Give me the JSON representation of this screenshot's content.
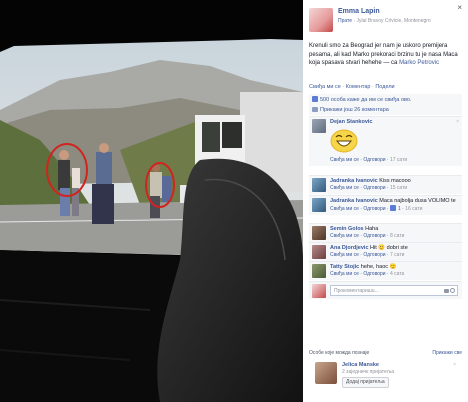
{
  "post": {
    "author": "Emma Lapin",
    "meta_prefix": "Прате",
    "meta_sep": " · ",
    "location": "Jylal Bravoy Crlvicie, Montenegro",
    "text": "Krenuli smo za Beograd jer nam je uskoro premijera pesama, ali kad Marko prekoraci brzinu tu je nasa Maca koja spasava stvari hehehe",
    "with_prefix": " — са ",
    "tagged": "Marko Petrovic",
    "close_label": "×",
    "actions": {
      "like": "Свиђа ми се",
      "comment": "Коментар",
      "share": "Подели"
    },
    "likes_text": "500 особа каже да им се свиђа ово.",
    "prev_comments": "Прикажи још 26 коментара"
  },
  "comments": [
    {
      "name": "Dejan Stankovic",
      "text": "",
      "has_sticker": true,
      "like": "Свиђа ми се",
      "reply": "Одговори",
      "time": "17 сати",
      "likes": ""
    },
    {
      "name": "Jadranka Ivanovic",
      "text": "Kiss macooo",
      "has_sticker": false,
      "like": "Свиђа ми се",
      "reply": "Одговори",
      "time": "15 сати",
      "likes": ""
    },
    {
      "name": "Jadranka Ivanovic",
      "text": "Maca najbolja dusa VOLIMO te",
      "has_sticker": false,
      "like": "Свиђа ми се",
      "reply": "Одговори",
      "time": "16 сати",
      "likes": "1"
    },
    {
      "name": "Semin Golos",
      "text": "Haha",
      "has_sticker": false,
      "like": "Свиђа ми се",
      "reply": "Одговори",
      "time": "8 сати",
      "likes": ""
    },
    {
      "name": "Ana Djordjevic",
      "text": "Hit 🙂 dobri ste",
      "has_sticker": false,
      "like": "Свиђа ми се",
      "reply": "Одговори",
      "time": "7 сати",
      "likes": ""
    },
    {
      "name": "Tatty Stojic",
      "text": "hehe, haoc 🙂",
      "has_sticker": false,
      "like": "Свиђа ми се",
      "reply": "Одговори",
      "time": "4 сата",
      "likes": ""
    }
  ],
  "write_comment": {
    "placeholder": "Прокоментаришu...",
    "camera_icon": "camera-icon",
    "emoji_icon": "emoji-icon"
  },
  "pymk": {
    "heading": "Особе које можда познаје",
    "see_all": "Прикажи све",
    "name": "Jelica Manske",
    "mutual": "2 заједничк пријатеља",
    "add_button": "Додај пријатеља",
    "dismiss": "×"
  },
  "colors": {
    "link": "#3b5998",
    "meta": "#90949c",
    "panel_bg": "#f6f7f9",
    "highlight_circle": "#d1231f"
  }
}
